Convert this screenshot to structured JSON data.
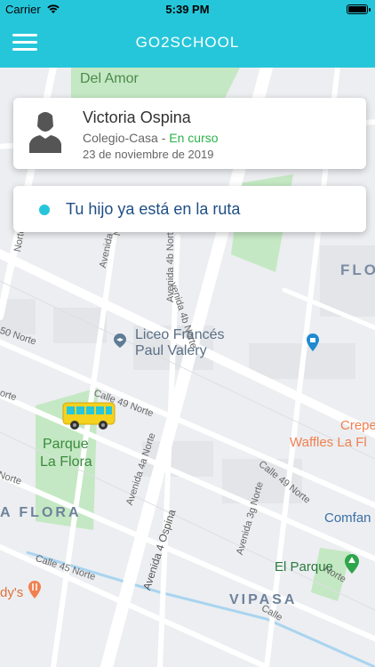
{
  "status_bar": {
    "carrier": "Carrier",
    "time": "5:39 PM"
  },
  "nav": {
    "title": "GO2SCHOOL"
  },
  "driver": {
    "name": "Victoria Ospina",
    "route": "Colegio-Casa - ",
    "route_status": "En curso",
    "date": "23 de noviembre de 2019"
  },
  "notice": {
    "text": "Tu hijo ya está en la ruta"
  },
  "map": {
    "labels": {
      "del_amor": "Del Amor",
      "flo": "FLO",
      "liceo": "Liceo Francés",
      "paul": "Paul Valery",
      "crepe": "Crepe",
      "waffles": "Waffles La Fl",
      "parque1": "Parque",
      "parque2": "La Flora",
      "la_flora": "A FLORA",
      "comfan": "Comfan",
      "el_parque": "El Parque",
      "vipasa": "VIPASA",
      "dys": "dy's",
      "norte_50": "50 Norte",
      "calle_49": "Calle 49 Norte",
      "calle_49b": "Calle 49 Norte",
      "calle_45": "Calle 45 Norte",
      "ave_4a": "Avenida 4a Norte",
      "ave_4_ospina": "Avenida 4 Ospina",
      "ave_3g": "Avenida 3g Norte",
      "ave_4b": "Avenida 4b Norte",
      "ave_plain": "Avenida",
      "avenida_4b_top": "venida 4b Norte",
      "norte_left1": "Norte",
      "norte_left2": "orte",
      "norte_left3": "Norte",
      "norte_mid": "Norte",
      "norte_right": "Norte",
      "calle_small": "Calle",
      "norte_small": "rte"
    },
    "colors": {
      "road": "#ffffff",
      "park": "#c4e8c3",
      "water": "#a8d4f0",
      "bus": "#f4d21e",
      "bus_window": "#26c6da"
    }
  }
}
